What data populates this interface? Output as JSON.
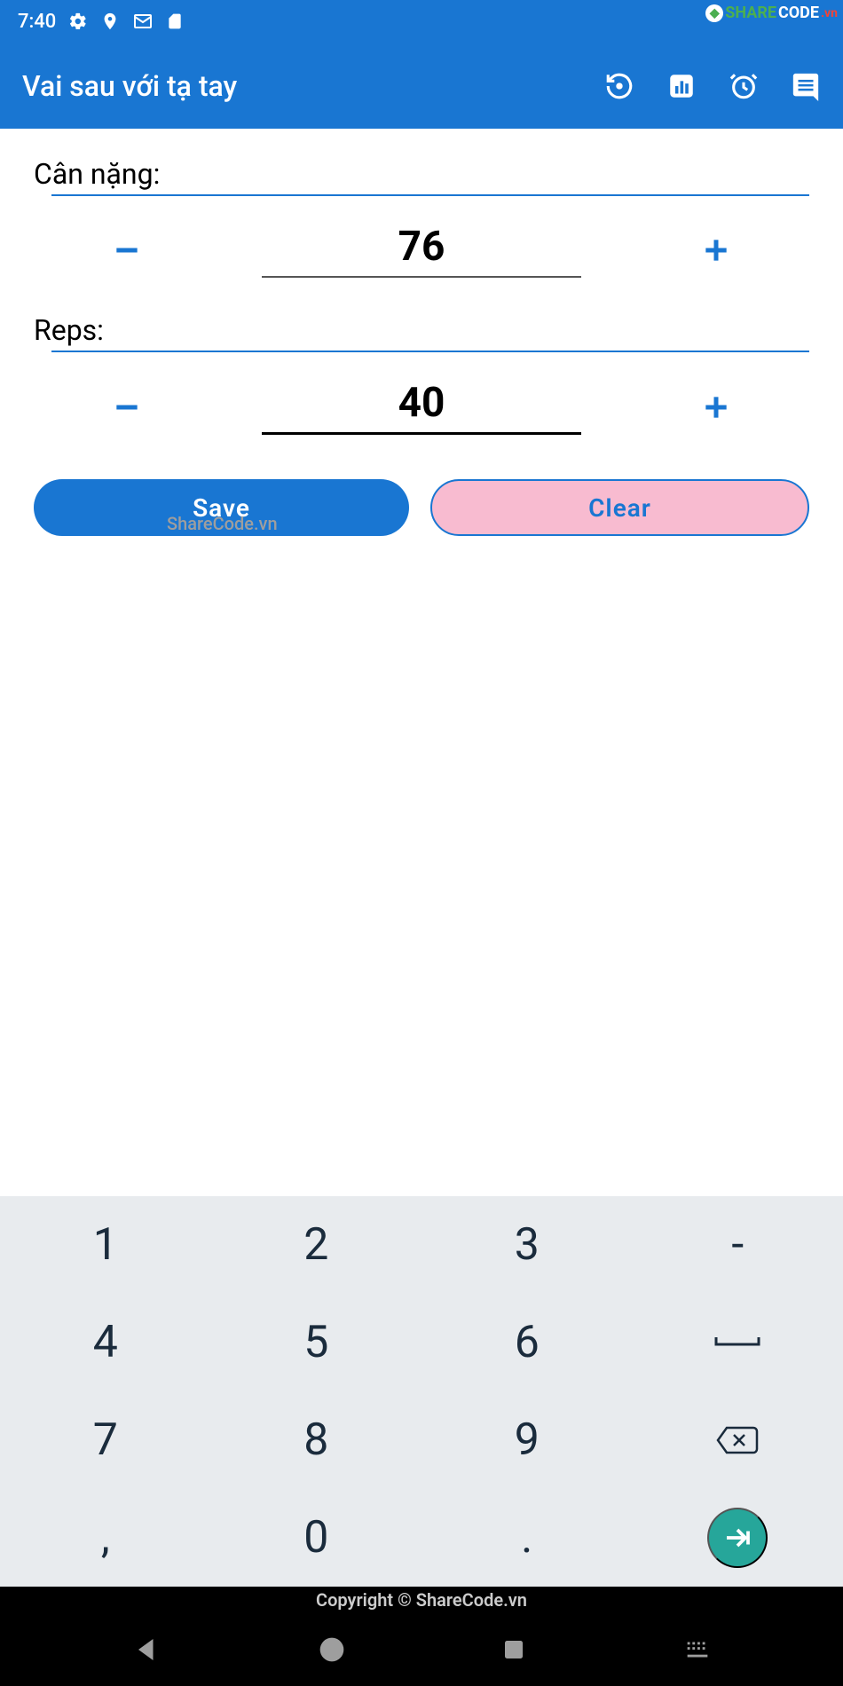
{
  "status": {
    "time": "7:40"
  },
  "topbar": {
    "title": "Vai sau với tạ tay"
  },
  "weight": {
    "label": "Cân nặng:",
    "value": "76"
  },
  "reps": {
    "label": "Reps:",
    "value": "40"
  },
  "buttons": {
    "save": "Save",
    "clear": "Clear"
  },
  "watermark": {
    "inline": "ShareCode.vn",
    "copyright": "Copyright © ShareCode.vn",
    "corner_share": "SHARE",
    "corner_code": "CODE",
    "corner_vn": ".vn"
  },
  "keypad": {
    "k1": "1",
    "k2": "2",
    "k3": "3",
    "kdash": "-",
    "k4": "4",
    "k5": "5",
    "k6": "6",
    "k7": "7",
    "k8": "8",
    "k9": "9",
    "kcomma": ",",
    "k0": "0",
    "kdot": "."
  }
}
